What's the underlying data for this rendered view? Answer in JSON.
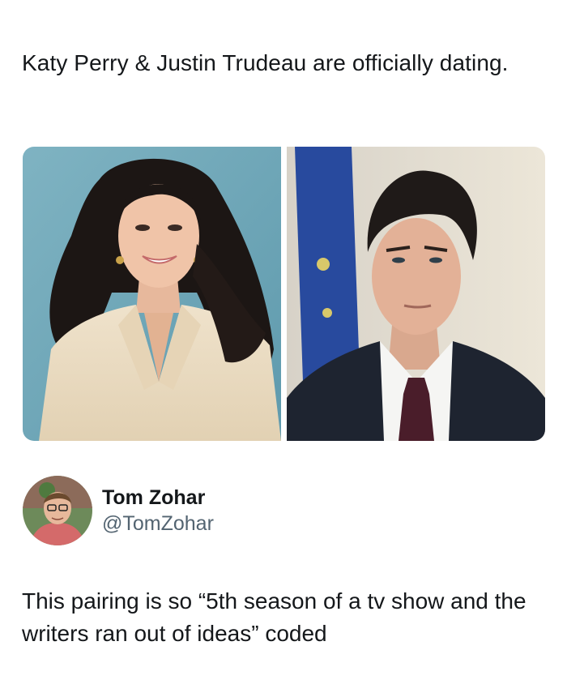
{
  "post": {
    "text": "Katy Perry & Justin Trudeau are officially dating."
  },
  "media": {
    "left_image": "photo-of-katy-perry",
    "right_image": "photo-of-justin-trudeau"
  },
  "reply": {
    "display_name": "Tom Zohar",
    "handle": "@TomZohar",
    "text": "This pairing is so “5th season of a tv show and the writers ran out of ideas” coded"
  },
  "colors": {
    "text": "#14171a",
    "handle": "#536471",
    "background": "#ffffff"
  }
}
